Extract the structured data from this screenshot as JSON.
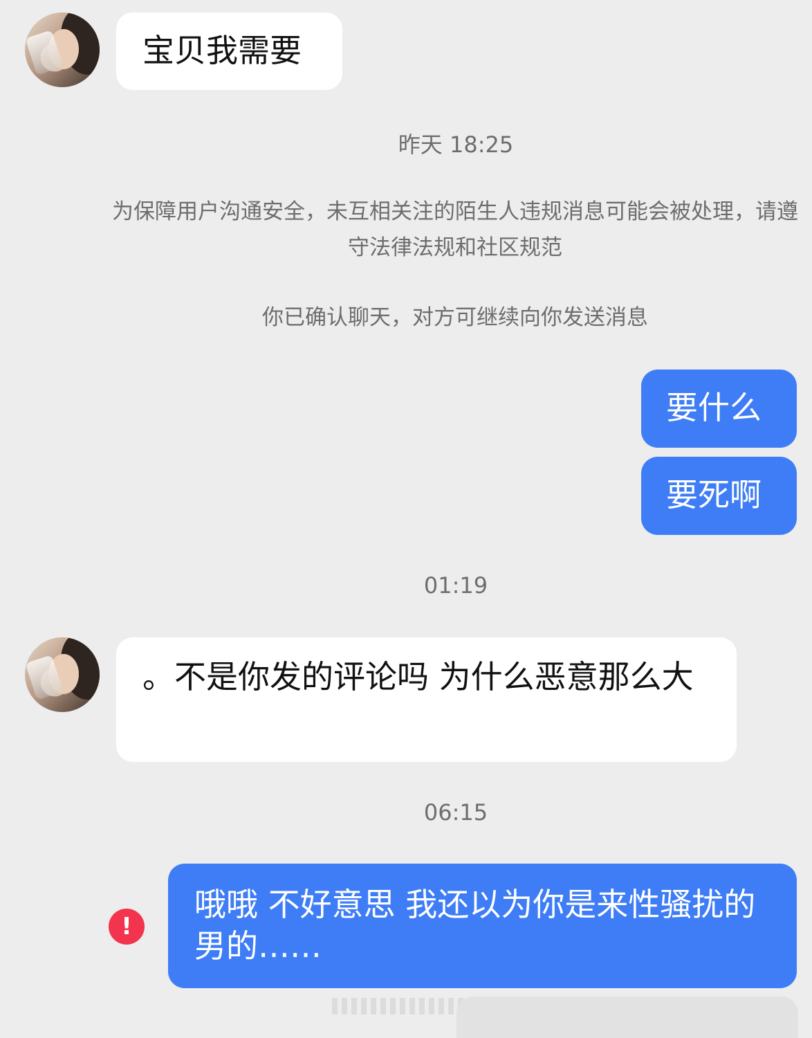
{
  "messages": [
    {
      "side": "in",
      "text": "宝贝我需要"
    },
    {
      "side": "out",
      "text": "要什么"
    },
    {
      "side": "out",
      "text": "要死啊"
    },
    {
      "side": "in",
      "text": "。不是你发的评论吗 为什么恶意那么大"
    },
    {
      "side": "out",
      "text": "哦哦 不好意思 我还以为你是来性骚扰的男的……",
      "status": "send-failed"
    }
  ],
  "timestamps": [
    "昨天 18:25",
    "01:19",
    "06:15"
  ],
  "system_notices": [
    "为保障用户沟通安全，未互相关注的陌生人违规消息可能会被处理，请遵守法律法规和社区规范",
    "你已确认聊天，对方可继续向你发送消息"
  ],
  "icons": {
    "error": "!"
  },
  "colors": {
    "background": "#ededed",
    "incoming_bubble": "#ffffff",
    "outgoing_bubble": "#3e7df6",
    "error": "#f2344f",
    "meta_text": "#6d6d6d"
  }
}
